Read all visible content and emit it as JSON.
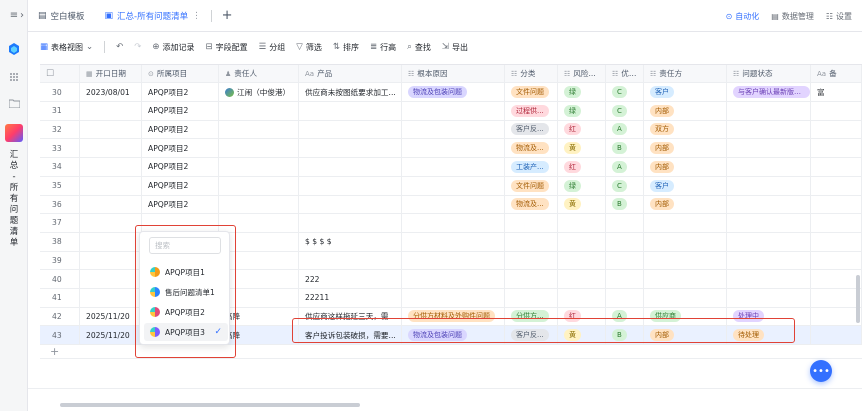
{
  "rail": {
    "menu_icon": "≡",
    "collapse_icon": "›",
    "title_chars": [
      "汇",
      "总",
      "-",
      "所",
      "有",
      "问",
      "题",
      "清",
      "单"
    ]
  },
  "tabs": [
    {
      "label": "空白模板",
      "icon": "table-icon",
      "active": false
    },
    {
      "label": "汇总-所有问题清单",
      "icon": "table-icon",
      "active": true
    }
  ],
  "tabs_more": "⋮",
  "tab_add": "+",
  "top_right": {
    "automation": "自动化",
    "data_mgmt": "数据管理",
    "settings": "设置"
  },
  "toolbar": {
    "view": "表格视图",
    "add_record": "添加记录",
    "field_config": "字段配置",
    "group": "分组",
    "filter": "筛选",
    "sort": "排序",
    "row_height": "行高",
    "find": "查找",
    "export": "导出"
  },
  "columns": [
    "开口日期",
    "所属项目",
    "责任人",
    "产品",
    "根本原因",
    "分类",
    "风险...",
    "优先级",
    "责任方",
    "问题状态",
    "备"
  ],
  "rows": [
    {
      "num": "30",
      "date": "2023/08/01",
      "project": "APQP项目2",
      "owner": "江闹（中俊港）",
      "product": "供应商未按图纸要求加工...",
      "cause": "物流及包装问题",
      "category": "文件问题",
      "risk": "绿",
      "priority": "C",
      "party": "客户",
      "status": "与客户确认最新版本开...",
      "extra": "富"
    },
    {
      "num": "31",
      "date": "",
      "project": "APQP项目2",
      "owner": "",
      "product": "",
      "cause": "",
      "category": "过程供...",
      "risk": "绿",
      "priority": "C",
      "party": "内部",
      "status": "",
      "extra": ""
    },
    {
      "num": "32",
      "date": "",
      "project": "APQP项目2",
      "owner": "",
      "product": "",
      "cause": "",
      "category": "客户反...",
      "risk": "红",
      "priority": "A",
      "party": "双方",
      "status": "",
      "extra": ""
    },
    {
      "num": "33",
      "date": "",
      "project": "APQP项目2",
      "owner": "",
      "product": "",
      "cause": "",
      "category": "物流及...",
      "risk": "黄",
      "priority": "B",
      "party": "内部",
      "status": "",
      "extra": ""
    },
    {
      "num": "34",
      "date": "",
      "project": "APQP项目2",
      "owner": "",
      "product": "",
      "cause": "",
      "category": "工装产...",
      "risk": "红",
      "priority": "A",
      "party": "内部",
      "status": "",
      "extra": ""
    },
    {
      "num": "35",
      "date": "",
      "project": "APQP项目2",
      "owner": "",
      "product": "",
      "cause": "",
      "category": "文件问题",
      "risk": "绿",
      "priority": "C",
      "party": "客户",
      "status": "",
      "extra": ""
    },
    {
      "num": "36",
      "date": "",
      "project": "APQP项目2",
      "owner": "",
      "product": "",
      "cause": "",
      "category": "物流及...",
      "risk": "黄",
      "priority": "B",
      "party": "内部",
      "status": "",
      "extra": ""
    },
    {
      "num": "37",
      "date": "",
      "project": "",
      "owner": "",
      "product": "",
      "cause": "",
      "category": "",
      "risk": "",
      "priority": "",
      "party": "",
      "status": "",
      "extra": ""
    },
    {
      "num": "38",
      "date": "",
      "project": "",
      "owner": "",
      "product": "$ $ $ $",
      "cause": "",
      "category": "",
      "risk": "",
      "priority": "",
      "party": "",
      "status": "",
      "extra": ""
    },
    {
      "num": "39",
      "date": "",
      "project": "",
      "owner": "",
      "product": "",
      "cause": "",
      "category": "",
      "risk": "",
      "priority": "",
      "party": "",
      "status": "",
      "extra": ""
    },
    {
      "num": "40",
      "date": "",
      "project": "",
      "owner": "",
      "product": "222",
      "cause": "",
      "category": "",
      "risk": "",
      "priority": "",
      "party": "",
      "status": "",
      "extra": ""
    },
    {
      "num": "41",
      "date": "",
      "project": "",
      "owner": "",
      "product": "22211",
      "cause": "",
      "category": "",
      "risk": "",
      "priority": "",
      "party": "",
      "status": "",
      "extra": ""
    },
    {
      "num": "42",
      "date": "2025/11/20",
      "project": "",
      "owner": "高降",
      "product": "供应商这样拖延三天，需...",
      "cause": "分供方材料及外购件问题",
      "category": "分供方...",
      "risk": "红",
      "priority": "A",
      "party": "供应商",
      "status": "处理中",
      "extra": ""
    },
    {
      "num": "43",
      "date": "2025/11/20",
      "project": "",
      "owner": "高降",
      "product": "客户投诉包装破损，需要...",
      "cause": "物流及包装问题",
      "category": "客户反...",
      "risk": "黄",
      "priority": "B",
      "party": "内部",
      "status": "待处理",
      "extra": ""
    }
  ],
  "add_row": "+",
  "dropdown": {
    "search_placeholder": "搜索",
    "options": [
      {
        "label": "APQP项目1",
        "icon": "project-icon",
        "color": "#f29b1a"
      },
      {
        "label": "售后问题清单1",
        "icon": "project-icon",
        "color": "#2b84ff"
      },
      {
        "label": "APQP项目2",
        "icon": "project-icon",
        "color": "#e04a7a"
      },
      {
        "label": "APQP项目3",
        "icon": "project-icon",
        "color": "#7b5cff",
        "selected": true
      }
    ],
    "check": "✓"
  },
  "fab_label": "•••",
  "colors": {
    "accent": "#3370ff",
    "annotation_red": "#e04236"
  }
}
